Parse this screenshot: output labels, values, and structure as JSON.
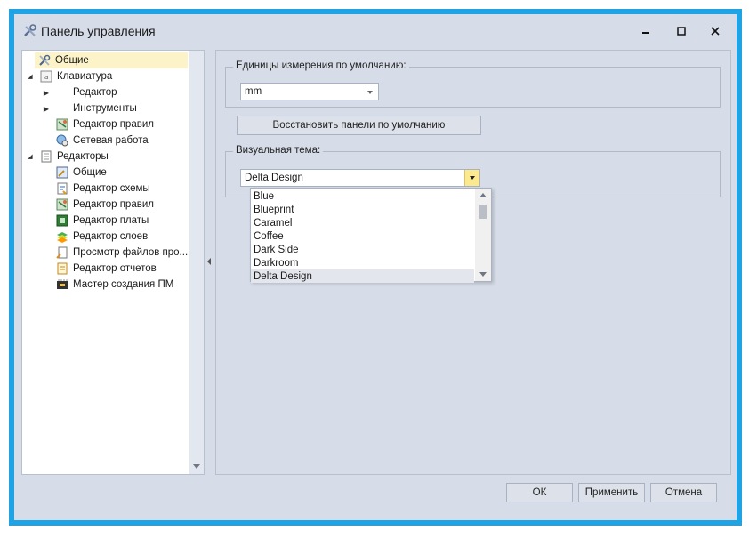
{
  "window": {
    "title": "Панель управления",
    "min_glyph": "–",
    "max_glyph": "☐",
    "close_glyph": "✕",
    "frame_color": "#1ea4e4"
  },
  "tree": {
    "items": [
      {
        "label": "Общие",
        "level": 0,
        "expander": "",
        "icon": "wrench-icon",
        "selected": true
      },
      {
        "label": "Клавиатура",
        "level": 0,
        "expander": "◢",
        "icon": "keyboard-icon"
      },
      {
        "label": "Редактор",
        "level": 1,
        "expander": "▶",
        "icon": ""
      },
      {
        "label": "Инструменты",
        "level": 1,
        "expander": "▶",
        "icon": ""
      },
      {
        "label": "Редактор правил",
        "level": 1,
        "expander": "",
        "icon": "rules-icon"
      },
      {
        "label": "Сетевая работа",
        "level": 1,
        "expander": "",
        "icon": "network-icon"
      },
      {
        "label": "Редакторы",
        "level": 0,
        "expander": "◢",
        "icon": "editors-icon"
      },
      {
        "label": "Общие",
        "level": 1,
        "expander": "",
        "icon": "general-icon"
      },
      {
        "label": "Редактор схемы",
        "level": 1,
        "expander": "",
        "icon": "schematic-icon"
      },
      {
        "label": "Редактор правил",
        "level": 1,
        "expander": "",
        "icon": "rules-icon"
      },
      {
        "label": "Редактор платы",
        "level": 1,
        "expander": "",
        "icon": "board-icon"
      },
      {
        "label": "Редактор слоев",
        "level": 1,
        "expander": "",
        "icon": "layers-icon"
      },
      {
        "label": "Просмотр файлов про...",
        "level": 1,
        "expander": "",
        "icon": "file-viewer-icon"
      },
      {
        "label": "Редактор отчетов",
        "level": 1,
        "expander": "",
        "icon": "report-icon"
      },
      {
        "label": "Мастер создания ПМ",
        "level": 1,
        "expander": "",
        "icon": "wizard-icon"
      }
    ]
  },
  "units": {
    "group_title": "Единицы измерения по умолчанию:",
    "value": "mm"
  },
  "restore_button": "Восстановить панели по умолчанию",
  "theme": {
    "group_title": "Визуальная тема:",
    "value": "Delta Design",
    "options": [
      "Blue",
      "Blueprint",
      "Caramel",
      "Coffee",
      "Dark Side",
      "Darkroom",
      "Delta Design"
    ],
    "selected_index": 6
  },
  "footer": {
    "ok": "ОК",
    "apply": "Применить",
    "cancel": "Отмена"
  }
}
